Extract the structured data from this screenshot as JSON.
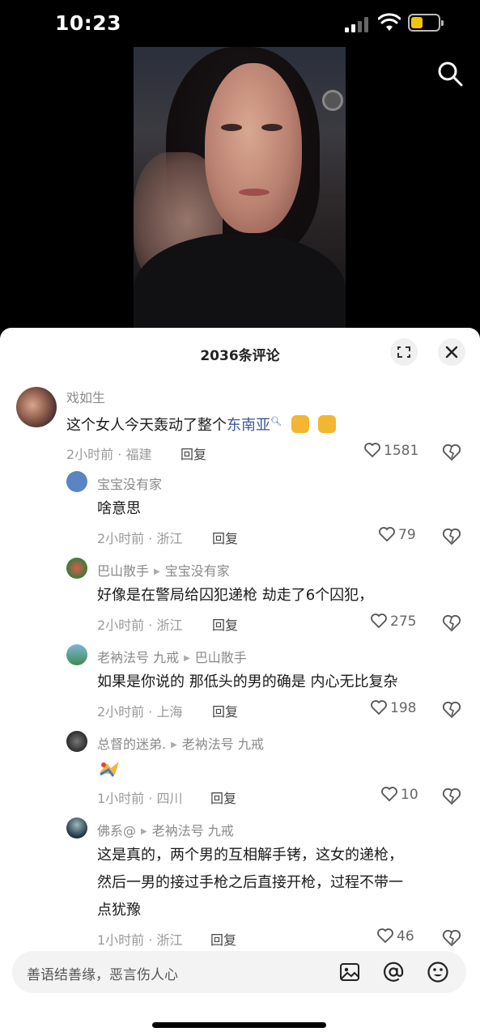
{
  "status": {
    "time": "10:23"
  },
  "icons": {
    "search": "search-icon",
    "expand": "expand-icon",
    "close": "close-icon",
    "like": "heart-icon",
    "dislike": "broken-heart-icon",
    "image": "image-icon",
    "mention": "at-icon",
    "emoji": "emoji-icon"
  },
  "colors": {
    "battery": "#f5c400",
    "link": "#3b5998"
  },
  "panel": {
    "title": "2036条评论"
  },
  "comments": [
    {
      "user": "戏如生",
      "text_before": "这个女人今天轰动了整个",
      "text_link": "东南亚",
      "time": "2小时前",
      "location": "福建",
      "reply": "回复",
      "likes": "1581"
    },
    {
      "user": "宝宝没有家",
      "text": "啥意思",
      "time": "2小时前",
      "location": "浙江",
      "reply": "回复",
      "likes": "79"
    },
    {
      "user": "巴山散手",
      "reply_to": "宝宝没有家",
      "text": "好像是在警局给囚犯递枪 劫走了6个囚犯，",
      "time": "2小时前",
      "location": "浙江",
      "reply": "回复",
      "likes": "275"
    },
    {
      "user": "老衲法号 九戒",
      "reply_to": "巴山散手",
      "text": "如果是你说的 那低头的男的确是 内心无比复杂",
      "time": "2小时前",
      "location": "上海",
      "reply": "回复",
      "likes": "198"
    },
    {
      "user": "总督的迷弟.",
      "reply_to": "老衲法号 九戒",
      "text": "",
      "time": "1小时前",
      "location": "四川",
      "reply": "回复",
      "likes": "10"
    },
    {
      "user": "佛系@",
      "reply_to": "老衲法号 九戒",
      "text_lines": [
        "这是真的，两个男的互相解手铐，这女的递枪，",
        "然后一男的接过手枪之后直接开枪，过程不带一",
        "点犹豫"
      ],
      "time": "1小时前",
      "location": "浙江",
      "reply": "回复",
      "likes": "46"
    }
  ],
  "input": {
    "placeholder": "善语结善缘，恶言伤人心"
  }
}
